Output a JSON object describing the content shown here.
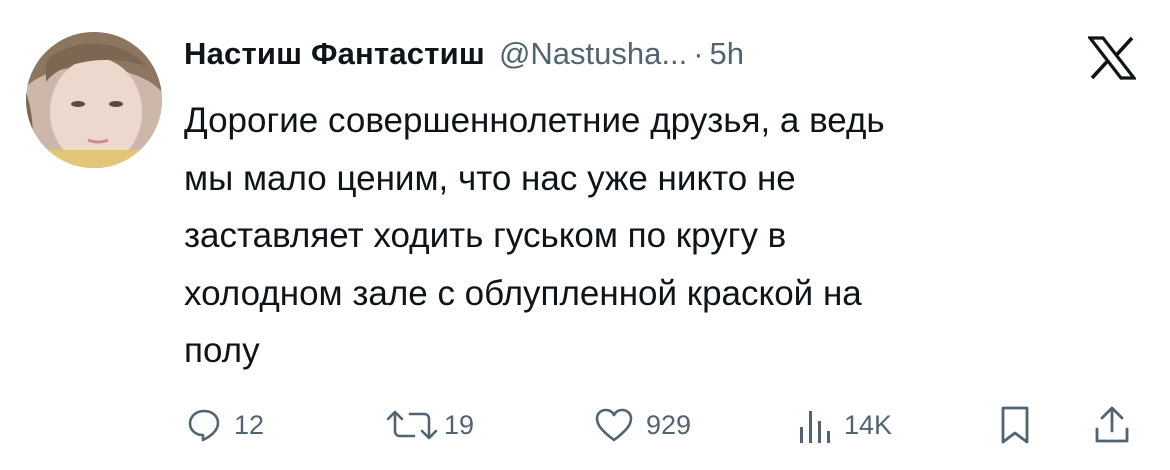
{
  "tweet": {
    "author_name": "Настиш Фантастиш",
    "author_handle": "@Nastusha...",
    "separator": "·",
    "time_ago": "5h",
    "text_lines": [
      "Дорогие совершеннолетние друзья, а ведь",
      "мы мало ценим, что нас уже никто не",
      "заставляет ходить гуськом по кругу в",
      "холодном зале с облупленной краской на",
      "полу"
    ]
  },
  "actions": {
    "replies": "12",
    "retweets": "19",
    "likes": "929",
    "views": "14K"
  },
  "icons": {
    "reply": "reply-icon",
    "retweet": "retweet-icon",
    "like": "heart-icon",
    "views": "views-icon",
    "bookmark": "bookmark-icon",
    "share": "share-icon",
    "platform": "x-logo-icon"
  },
  "colors": {
    "text": "#0f1419",
    "secondary": "#536471",
    "background": "#ffffff"
  }
}
